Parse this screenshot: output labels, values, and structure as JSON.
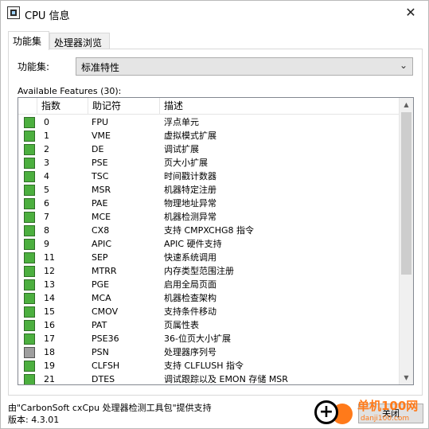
{
  "window": {
    "title": "CPU 信息",
    "close_glyph": "✕"
  },
  "tabs": [
    {
      "label": "功能集",
      "active": true
    },
    {
      "label": "处理器浏览",
      "active": false
    }
  ],
  "featureset": {
    "label": "功能集:",
    "selected": "标准特性"
  },
  "available_label": "Available Features (30):",
  "columns": {
    "index": "指数",
    "mnemonic": "助记符",
    "description": "描述"
  },
  "rows": [
    {
      "enabled": true,
      "index": "0",
      "mnemonic": "FPU",
      "description": "浮点单元"
    },
    {
      "enabled": true,
      "index": "1",
      "mnemonic": "VME",
      "description": "虚拟模式扩展"
    },
    {
      "enabled": true,
      "index": "2",
      "mnemonic": "DE",
      "description": "调试扩展"
    },
    {
      "enabled": true,
      "index": "3",
      "mnemonic": "PSE",
      "description": "页大小扩展"
    },
    {
      "enabled": true,
      "index": "4",
      "mnemonic": "TSC",
      "description": "时间戳计数器"
    },
    {
      "enabled": true,
      "index": "5",
      "mnemonic": "MSR",
      "description": "机器特定注册"
    },
    {
      "enabled": true,
      "index": "6",
      "mnemonic": "PAE",
      "description": "物理地址异常"
    },
    {
      "enabled": true,
      "index": "7",
      "mnemonic": "MCE",
      "description": "机器检测异常"
    },
    {
      "enabled": true,
      "index": "8",
      "mnemonic": "CX8",
      "description": "支持 CMPXCHG8 指令"
    },
    {
      "enabled": true,
      "index": "9",
      "mnemonic": "APIC",
      "description": "APIC 硬件支持"
    },
    {
      "enabled": true,
      "index": "11",
      "mnemonic": "SEP",
      "description": "快速系统调用"
    },
    {
      "enabled": true,
      "index": "12",
      "mnemonic": "MTRR",
      "description": "内存类型范围注册"
    },
    {
      "enabled": true,
      "index": "13",
      "mnemonic": "PGE",
      "description": "启用全局页面"
    },
    {
      "enabled": true,
      "index": "14",
      "mnemonic": "MCA",
      "description": "机器检查架构"
    },
    {
      "enabled": true,
      "index": "15",
      "mnemonic": "CMOV",
      "description": "支持条件移动"
    },
    {
      "enabled": true,
      "index": "16",
      "mnemonic": "PAT",
      "description": "页属性表"
    },
    {
      "enabled": true,
      "index": "17",
      "mnemonic": "PSE36",
      "description": "36-位页大小扩展"
    },
    {
      "enabled": false,
      "index": "18",
      "mnemonic": "PSN",
      "description": "处理器序列号"
    },
    {
      "enabled": true,
      "index": "19",
      "mnemonic": "CLFSH",
      "description": "支持 CLFLUSH 指令"
    },
    {
      "enabled": true,
      "index": "21",
      "mnemonic": "DTES",
      "description": "调试跟踪以及 EMON 存储 MSR"
    }
  ],
  "footer": {
    "credit": "由\"CarbonSoft cxCpu 处理器检测工具包\"提供支持",
    "version": "版本: 4.3.01"
  },
  "close_button_label": "关闭",
  "watermark": {
    "plus_glyph": "+",
    "text": "单机100网",
    "url": "danji100.com"
  },
  "colors": {
    "enabled_box": "#4caf3f",
    "disabled_box": "#9e9e9e",
    "watermark_orange": "#ff7a1a"
  }
}
